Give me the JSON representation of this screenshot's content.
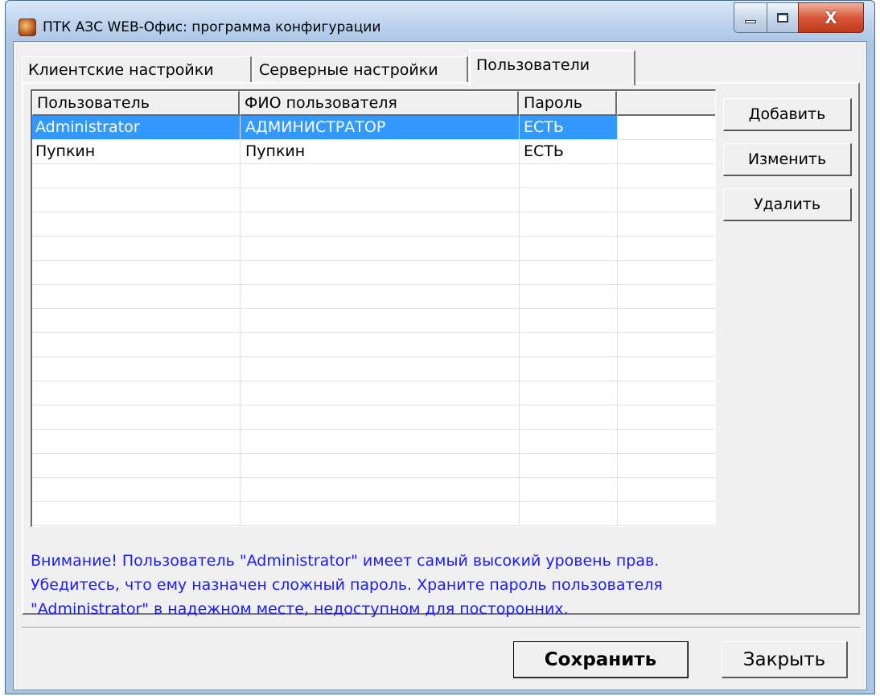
{
  "window": {
    "title": "ПТК АЗС WEB-Офис: программа конфигурации",
    "minimize_glyph": "",
    "maximize_glyph": "",
    "close_glyph": "X"
  },
  "tabs": [
    {
      "label": "Клиентские настройки",
      "active": false
    },
    {
      "label": "Серверные настройки",
      "active": false
    },
    {
      "label": "Пользователи",
      "active": true
    }
  ],
  "users_table": {
    "columns": [
      "Пользователь",
      "ФИО пользователя",
      "Пароль",
      ""
    ],
    "rows": [
      {
        "user": "Administrator",
        "full_name": "АДМИНИСТРАТОР",
        "password": "ЕСТЬ",
        "selected": true
      },
      {
        "user": "Пупкин",
        "full_name": "Пупкин",
        "password": "ЕСТЬ",
        "selected": false
      }
    ]
  },
  "side_buttons": {
    "add": "Добавить",
    "edit": "Изменить",
    "delete": "Удалить"
  },
  "warning": {
    "lines": [
      "Внимание! Пользователь \"Administrator\" имеет самый высокий уровень прав.",
      "Убедитесь, что ему назначен сложный пароль. Храните пароль пользователя",
      "\"Administrator\" в надежном месте, недоступном для посторонних."
    ],
    "color": "#1a1aff"
  },
  "footer": {
    "save": "Сохранить",
    "close": "Закрыть"
  },
  "colors": {
    "selection": "#3399ff",
    "title_bar": "#b8d0ec",
    "close_button": "#d9573a",
    "dialog_bg": "#f0f0f0"
  }
}
